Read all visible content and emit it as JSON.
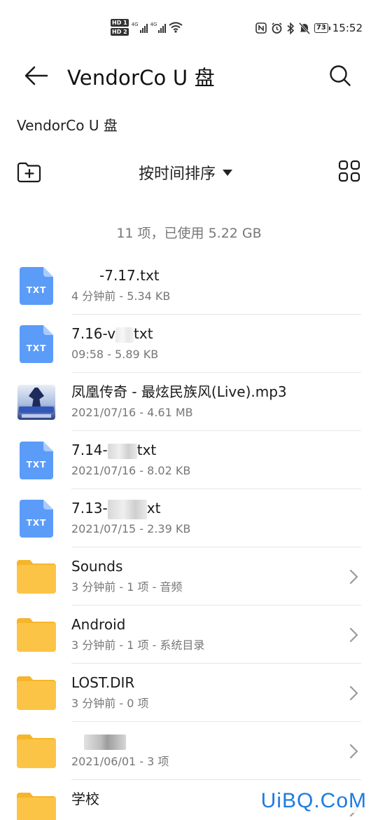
{
  "status_bar": {
    "hd1": "HD 1",
    "hd2": "HD 2",
    "net1": "4G",
    "net2": "4G",
    "battery": "73",
    "time": "15:52"
  },
  "app_bar": {
    "title": "VendorCo U 盘"
  },
  "breadcrumb": "VendorCo U 盘",
  "toolbar": {
    "sort_label": "按时间排序"
  },
  "summary": "11 项，已使用 5.22 GB",
  "files": [
    {
      "type": "txt",
      "icon_label": "TXT",
      "name": "-7.17.txt",
      "meta": "4 分钟前 - 5.34 KB"
    },
    {
      "type": "txt",
      "icon_label": "TXT",
      "name_prefix": "7.16-v",
      "name_suffix": "txt",
      "meta": "09:58 - 5.89 KB"
    },
    {
      "type": "audio",
      "name": "凤凰传奇 - 最炫民族风(Live).mp3",
      "meta": "2021/07/16 - 4.61 MB"
    },
    {
      "type": "txt",
      "icon_label": "TXT",
      "name_prefix": "7.14-",
      "name_suffix": "txt",
      "meta": "2021/07/16 - 8.02 KB"
    },
    {
      "type": "txt",
      "icon_label": "TXT",
      "name_prefix": "7.13-",
      "name_suffix": "xt",
      "meta": "2021/07/15 - 2.39 KB"
    },
    {
      "type": "folder",
      "name": "Sounds",
      "meta": "3 分钟前 - 1 项 - 音频"
    },
    {
      "type": "folder",
      "name": "Android",
      "meta": "3 分钟前 - 1 项 - 系统目录"
    },
    {
      "type": "folder",
      "name": "LOST.DIR",
      "meta": "3 分钟前 - 0 项"
    },
    {
      "type": "folder",
      "name": "",
      "meta": "2021/06/01 - 3 项"
    },
    {
      "type": "folder",
      "name": "学校",
      "meta": ""
    }
  ],
  "watermark": "UiBQ.CoM",
  "colors": {
    "txt_icon": "#5b9cf8",
    "folder": "#fcc447",
    "folder_tab": "#f6b52a",
    "accent_watermark": "#1e7be0"
  }
}
